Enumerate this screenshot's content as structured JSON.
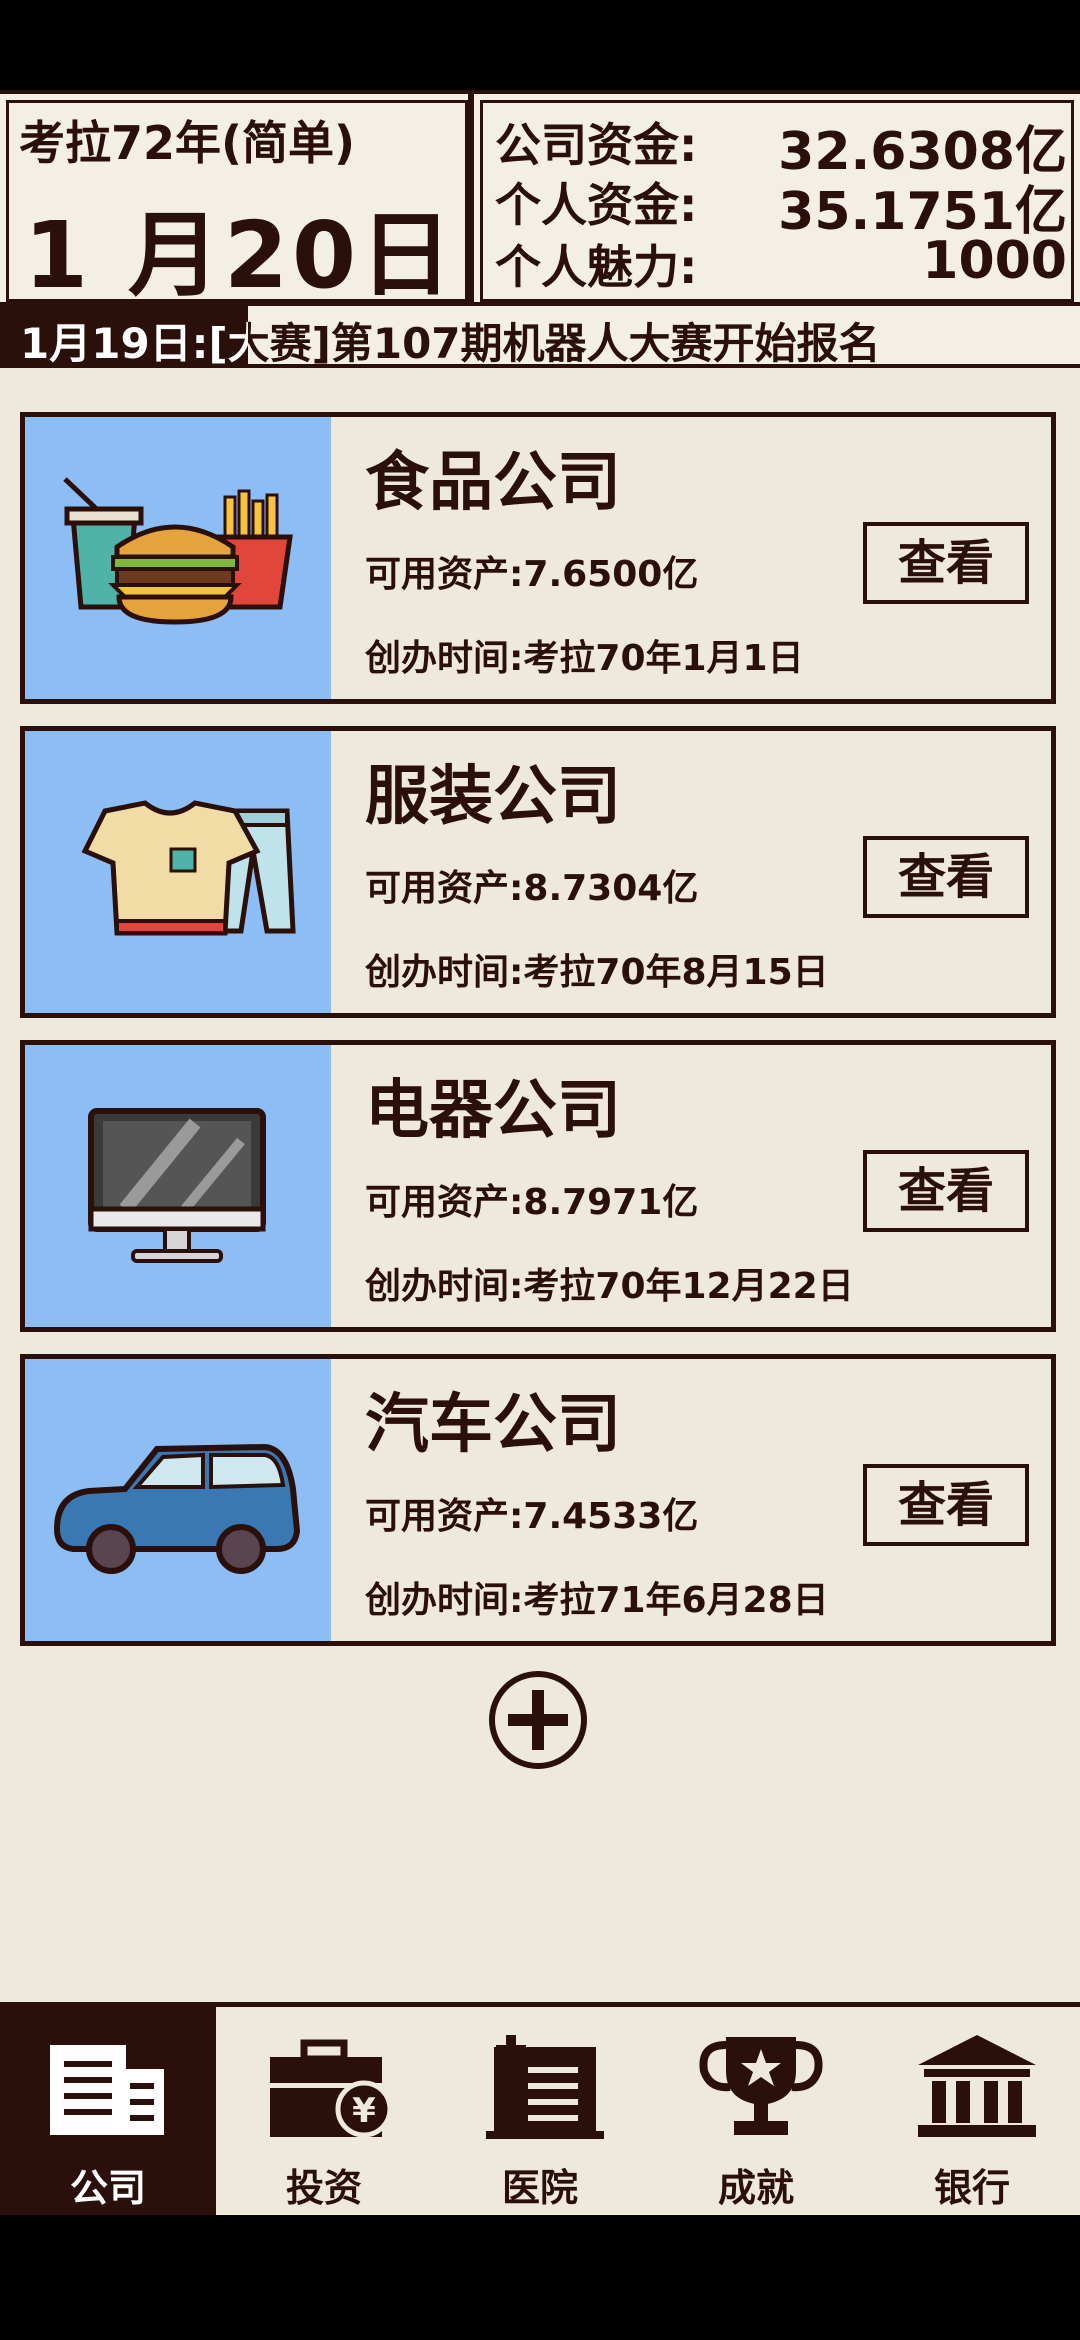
{
  "header": {
    "year_label": "考拉72年(简单)",
    "date": "1 月20日",
    "funds": [
      {
        "label": "公司资金:",
        "value": "32.6308亿"
      },
      {
        "label": "个人资金:",
        "value": "35.1751亿"
      },
      {
        "label": "个人魅力:",
        "value": "1000"
      }
    ]
  },
  "ticker": {
    "text": "1月19日:[大赛]第107期机器人大赛开始报名"
  },
  "companies": [
    {
      "name": "食品公司",
      "assets": "可用资产:7.6500亿",
      "founded": "创办时间:考拉70年1月1日",
      "button": "查看",
      "icon": "fast-food-icon"
    },
    {
      "name": "服装公司",
      "assets": "可用资产:8.7304亿",
      "founded": "创办时间:考拉70年8月15日",
      "button": "查看",
      "icon": "clothing-icon"
    },
    {
      "name": "电器公司",
      "assets": "可用资产:8.7971亿",
      "founded": "创办时间:考拉70年12月22日",
      "button": "查看",
      "icon": "monitor-icon"
    },
    {
      "name": "汽车公司",
      "assets": "可用资产:7.4533亿",
      "founded": "创办时间:考拉71年6月28日",
      "button": "查看",
      "icon": "car-icon"
    }
  ],
  "add_button_icon": "plus-circle-icon",
  "nav": [
    {
      "label": "公司",
      "icon": "office-building-icon",
      "active": true
    },
    {
      "label": "投资",
      "icon": "briefcase-yen-icon",
      "active": false
    },
    {
      "label": "医院",
      "icon": "hospital-icon",
      "active": false
    },
    {
      "label": "成就",
      "icon": "trophy-icon",
      "active": false
    },
    {
      "label": "银行",
      "icon": "bank-icon",
      "active": false
    }
  ],
  "colors": {
    "dark_brown": "#2a0f0a",
    "background": "#efe9dc",
    "card_image_blue": "#8dbdf5"
  }
}
